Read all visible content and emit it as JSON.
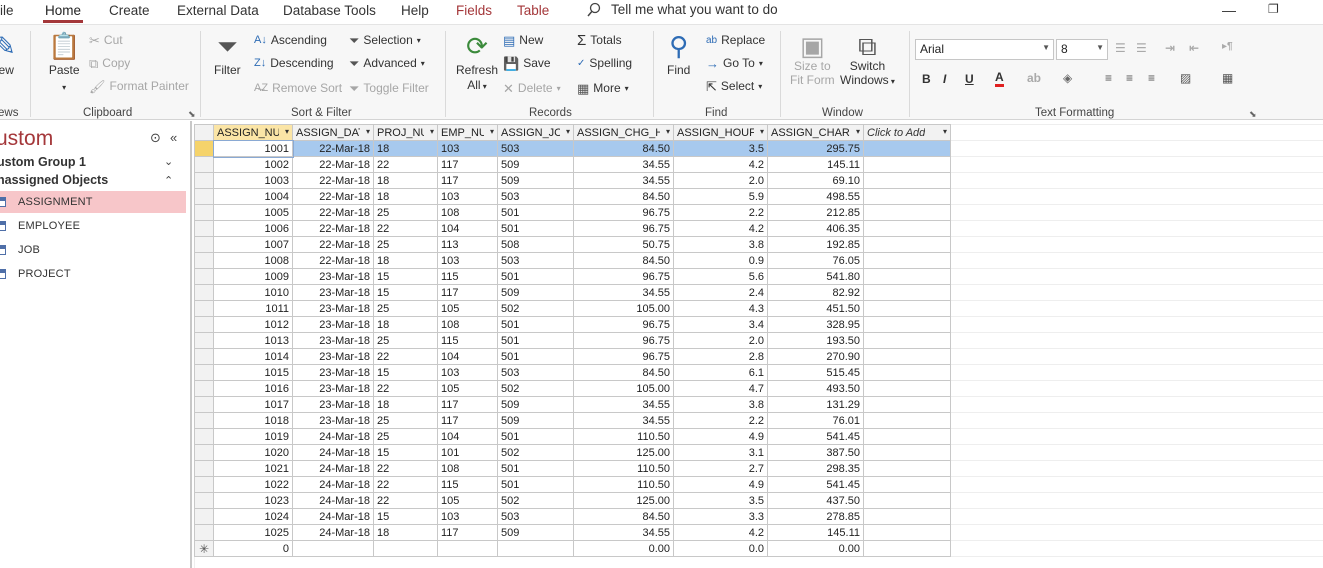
{
  "menu": {
    "tabs": [
      "ile",
      "Home",
      "Create",
      "External Data",
      "Database Tools",
      "Help",
      "Fields",
      "Table"
    ],
    "active": "Home",
    "tell_me": "Tell me what you want to do"
  },
  "ribbon": {
    "views_label": "ews",
    "views_btn": "iew",
    "clipboard": {
      "label": "Clipboard",
      "paste": "Paste",
      "cut": "Cut",
      "copy": "Copy",
      "format_painter": "Format Painter"
    },
    "sort_filter": {
      "label": "Sort & Filter",
      "filter": "Filter",
      "ascending": "Ascending",
      "descending": "Descending",
      "remove_sort": "Remove Sort",
      "selection": "Selection",
      "advanced": "Advanced",
      "toggle_filter": "Toggle Filter"
    },
    "records": {
      "label": "Records",
      "refresh": "Refresh",
      "refresh_all": "All",
      "new": "New",
      "save": "Save",
      "delete": "Delete",
      "totals": "Totals",
      "spelling": "Spelling",
      "more": "More"
    },
    "find": {
      "label": "Find",
      "find": "Find",
      "replace": "Replace",
      "goto": "Go To",
      "select": "Select"
    },
    "window": {
      "label": "Window",
      "size_to_fit_1": "Size to",
      "size_to_fit_2": "Fit Form",
      "switch_1": "Switch",
      "switch_2": "Windows"
    },
    "text_formatting": {
      "label": "Text Formatting",
      "font": "Arial",
      "size": "8",
      "bold": "B",
      "italic": "I",
      "underline": "U"
    }
  },
  "nav": {
    "title": "ustom",
    "groups": [
      "ustom Group 1",
      "nassigned Objects"
    ],
    "items": [
      "ASSIGNMENT",
      "EMPLOYEE",
      "JOB",
      "PROJECT"
    ],
    "selected": "ASSIGNMENT"
  },
  "table": {
    "columns": [
      "ASSIGN_NU",
      "ASSIGN_DAT",
      "PROJ_NU",
      "EMP_NU",
      "ASSIGN_JC",
      "ASSIGN_CHG_H",
      "ASSIGN_HOUF",
      "ASSIGN_CHAR",
      "Click to Add"
    ],
    "rows": [
      [
        "1001",
        "22-Mar-18",
        "18",
        "103",
        "503",
        "84.50",
        "3.5",
        "295.75"
      ],
      [
        "1002",
        "22-Mar-18",
        "22",
        "117",
        "509",
        "34.55",
        "4.2",
        "145.11"
      ],
      [
        "1003",
        "22-Mar-18",
        "18",
        "117",
        "509",
        "34.55",
        "2.0",
        "69.10"
      ],
      [
        "1004",
        "22-Mar-18",
        "18",
        "103",
        "503",
        "84.50",
        "5.9",
        "498.55"
      ],
      [
        "1005",
        "22-Mar-18",
        "25",
        "108",
        "501",
        "96.75",
        "2.2",
        "212.85"
      ],
      [
        "1006",
        "22-Mar-18",
        "22",
        "104",
        "501",
        "96.75",
        "4.2",
        "406.35"
      ],
      [
        "1007",
        "22-Mar-18",
        "25",
        "113",
        "508",
        "50.75",
        "3.8",
        "192.85"
      ],
      [
        "1008",
        "22-Mar-18",
        "18",
        "103",
        "503",
        "84.50",
        "0.9",
        "76.05"
      ],
      [
        "1009",
        "23-Mar-18",
        "15",
        "115",
        "501",
        "96.75",
        "5.6",
        "541.80"
      ],
      [
        "1010",
        "23-Mar-18",
        "15",
        "117",
        "509",
        "34.55",
        "2.4",
        "82.92"
      ],
      [
        "1011",
        "23-Mar-18",
        "25",
        "105",
        "502",
        "105.00",
        "4.3",
        "451.50"
      ],
      [
        "1012",
        "23-Mar-18",
        "18",
        "108",
        "501",
        "96.75",
        "3.4",
        "328.95"
      ],
      [
        "1013",
        "23-Mar-18",
        "25",
        "115",
        "501",
        "96.75",
        "2.0",
        "193.50"
      ],
      [
        "1014",
        "23-Mar-18",
        "22",
        "104",
        "501",
        "96.75",
        "2.8",
        "270.90"
      ],
      [
        "1015",
        "23-Mar-18",
        "15",
        "103",
        "503",
        "84.50",
        "6.1",
        "515.45"
      ],
      [
        "1016",
        "23-Mar-18",
        "22",
        "105",
        "502",
        "105.00",
        "4.7",
        "493.50"
      ],
      [
        "1017",
        "23-Mar-18",
        "18",
        "117",
        "509",
        "34.55",
        "3.8",
        "131.29"
      ],
      [
        "1018",
        "23-Mar-18",
        "25",
        "117",
        "509",
        "34.55",
        "2.2",
        "76.01"
      ],
      [
        "1019",
        "24-Mar-18",
        "25",
        "104",
        "501",
        "110.50",
        "4.9",
        "541.45"
      ],
      [
        "1020",
        "24-Mar-18",
        "15",
        "101",
        "502",
        "125.00",
        "3.1",
        "387.50"
      ],
      [
        "1021",
        "24-Mar-18",
        "22",
        "108",
        "501",
        "110.50",
        "2.7",
        "298.35"
      ],
      [
        "1022",
        "24-Mar-18",
        "22",
        "115",
        "501",
        "110.50",
        "4.9",
        "541.45"
      ],
      [
        "1023",
        "24-Mar-18",
        "22",
        "105",
        "502",
        "125.00",
        "3.5",
        "437.50"
      ],
      [
        "1024",
        "24-Mar-18",
        "15",
        "103",
        "503",
        "84.50",
        "3.3",
        "278.85"
      ],
      [
        "1025",
        "24-Mar-18",
        "18",
        "117",
        "509",
        "34.55",
        "4.2",
        "145.11"
      ]
    ],
    "new_row": [
      "0",
      "",
      "",
      "",
      "",
      "0.00",
      "0.0",
      "0.00"
    ],
    "new_row_marker": "✳"
  }
}
